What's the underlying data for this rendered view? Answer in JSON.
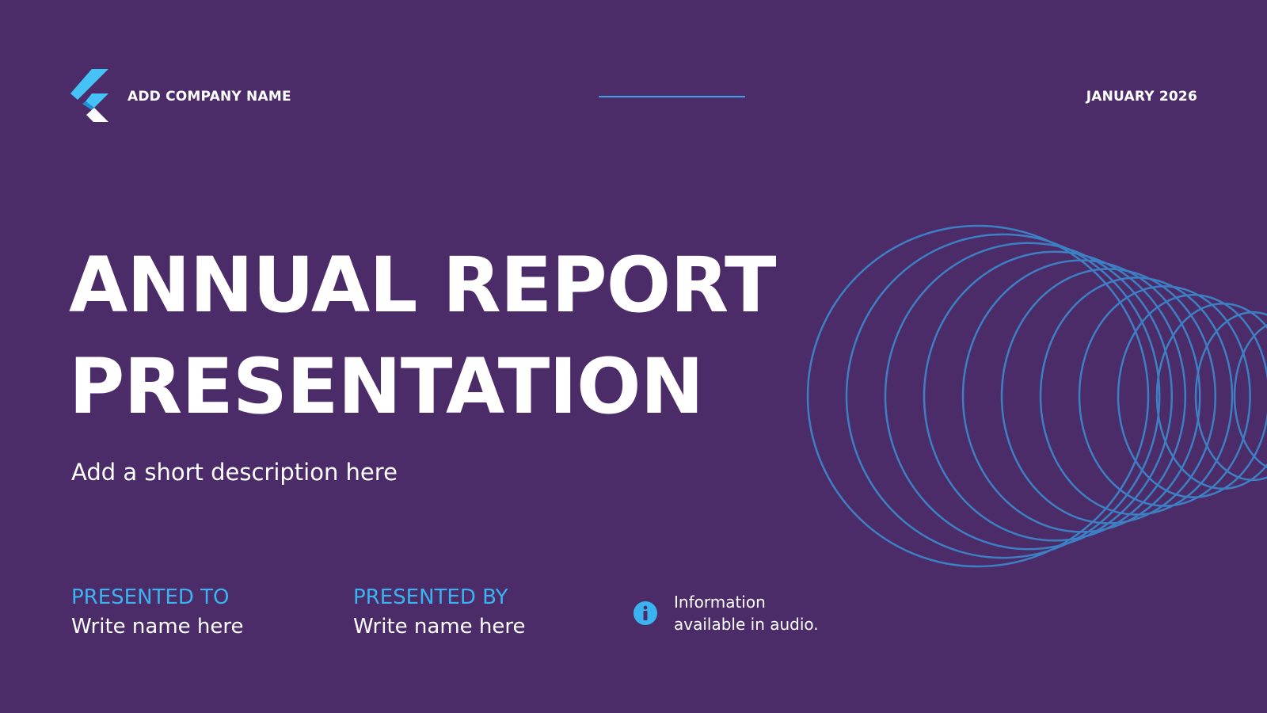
{
  "header": {
    "company_name": "ADD COMPANY NAME",
    "date": "JANUARY 2026",
    "logo_icon": "flutter-logo-icon"
  },
  "title": {
    "line1": "ANNUAL REPORT",
    "line2": "PRESENTATION"
  },
  "description": "Add a short description here",
  "presented_to": {
    "label": "PRESENTED TO",
    "name": "Write name here"
  },
  "presented_by": {
    "label": "PRESENTED BY",
    "name": "Write name here"
  },
  "info": {
    "icon": "info-icon",
    "line1": "Information",
    "line2": "available in audio."
  },
  "colors": {
    "background": "#4b2c69",
    "accent": "#3bb3f1",
    "ring_stroke": "#3d7fc2",
    "text": "#ffffff"
  }
}
